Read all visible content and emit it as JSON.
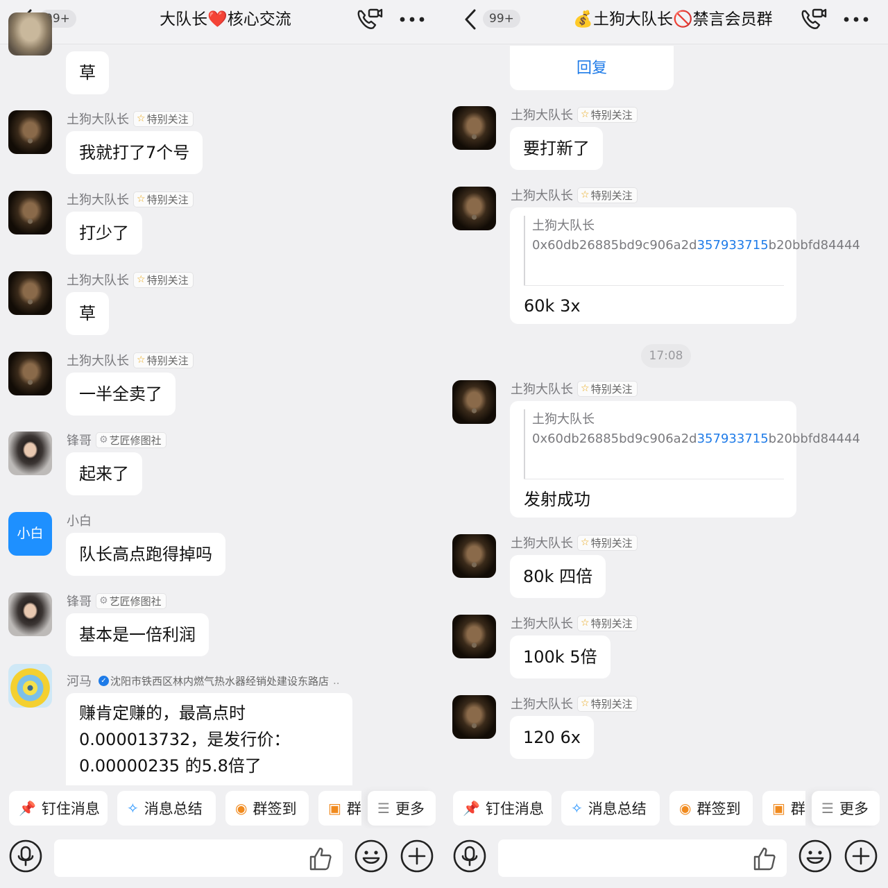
{
  "left": {
    "header": {
      "badge": "99+",
      "title": "大队长❤️核心交流"
    },
    "messages": [
      {
        "sender": "",
        "tag": "",
        "text": "草"
      },
      {
        "sender": "土狗大队长",
        "tag": "特别关注",
        "text": "我就打了7个号"
      },
      {
        "sender": "土狗大队长",
        "tag": "特别关注",
        "text": "打少了"
      },
      {
        "sender": "土狗大队长",
        "tag": "特别关注",
        "text": "草"
      },
      {
        "sender": "土狗大队长",
        "tag": "特别关注",
        "text": "一半全卖了"
      },
      {
        "sender": "锋哥",
        "tag": "艺匠修图社",
        "text": "起来了"
      },
      {
        "sender": "小白",
        "tag": "",
        "avatar_text": "小白",
        "text": "队长高点跑得掉吗"
      },
      {
        "sender": "锋哥",
        "tag": "艺匠修图社",
        "text": "基本是一倍利润"
      },
      {
        "sender": "河马",
        "tag": "沈阳市铁西区林内燃气热水器经销处建设东路店",
        "tag_more": "..",
        "lines": [
          "赚肯定赚的，最高点时",
          "0.000013732，是发行价：",
          "0.00000235 的5.8倍了"
        ]
      }
    ],
    "quick_actions": [
      "钉住消息",
      "消息总结",
      "群签到",
      "群",
      "更多"
    ]
  },
  "right": {
    "header": {
      "badge": "99+",
      "title": "💰土狗大队长🚫禁言会员群"
    },
    "reply_label": "回复",
    "time_label": "17:08",
    "messages": [
      {
        "sender": "土狗大队长",
        "tag": "特别关注",
        "text": "要打新了"
      },
      {
        "sender": "土狗大队长",
        "tag": "特别关注",
        "quote_author": "土狗大队长",
        "quote_prefix": "0x60db26885bd9c906a2d",
        "quote_link": "357933715",
        "quote_suffix": "b20bbfd84444",
        "text": "60k 3x"
      },
      {
        "sender": "土狗大队长",
        "tag": "特别关注",
        "quote_author": "土狗大队长",
        "quote_prefix": "0x60db26885bd9c906a2d",
        "quote_link": "357933715",
        "quote_suffix": "b20bbfd84444",
        "text": "发射成功"
      },
      {
        "sender": "土狗大队长",
        "tag": "特别关注",
        "text": "80k 四倍"
      },
      {
        "sender": "土狗大队长",
        "tag": "特别关注",
        "text": "100k 5倍"
      },
      {
        "sender": "土狗大队长",
        "tag": "特别关注",
        "text": "120 6x"
      }
    ],
    "quick_actions": [
      "钉住消息",
      "消息总结",
      "群签到",
      "群",
      "更多"
    ]
  },
  "colors": {
    "accent": "#1e7be8",
    "star": "#e8a515",
    "background": "#f0f0f2",
    "bubble": "#ffffff"
  },
  "icons": [
    "back-icon",
    "video-call-icon",
    "more-icon",
    "pin-icon",
    "summary-icon",
    "checkin-icon",
    "tv-icon",
    "list-icon",
    "voice-icon",
    "thumb-up-icon",
    "emoji-icon",
    "plus-icon",
    "star-icon",
    "gear-icon",
    "verified-icon"
  ]
}
